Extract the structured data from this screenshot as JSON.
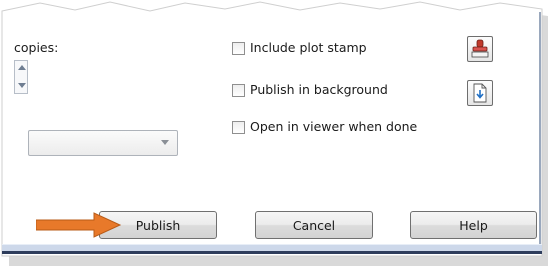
{
  "copies": {
    "label": "copies:"
  },
  "options": {
    "include_plot_stamp": {
      "label": "Include plot stamp",
      "checked": false
    },
    "publish_in_background": {
      "label": "Publish in background",
      "checked": false
    },
    "open_in_viewer": {
      "label": "Open in viewer when done",
      "checked": false
    }
  },
  "buttons": {
    "publish": "Publish",
    "cancel": "Cancel",
    "help": "Help"
  },
  "icons": {
    "plot_stamp": "stamp-icon",
    "publish_options": "document-download-icon",
    "pointer": "orange-arrow-icon"
  },
  "colors": {
    "arrow": "#e8792a",
    "frame_edge": "#2e3d5c",
    "bottom_band": "#cdd8ea"
  }
}
